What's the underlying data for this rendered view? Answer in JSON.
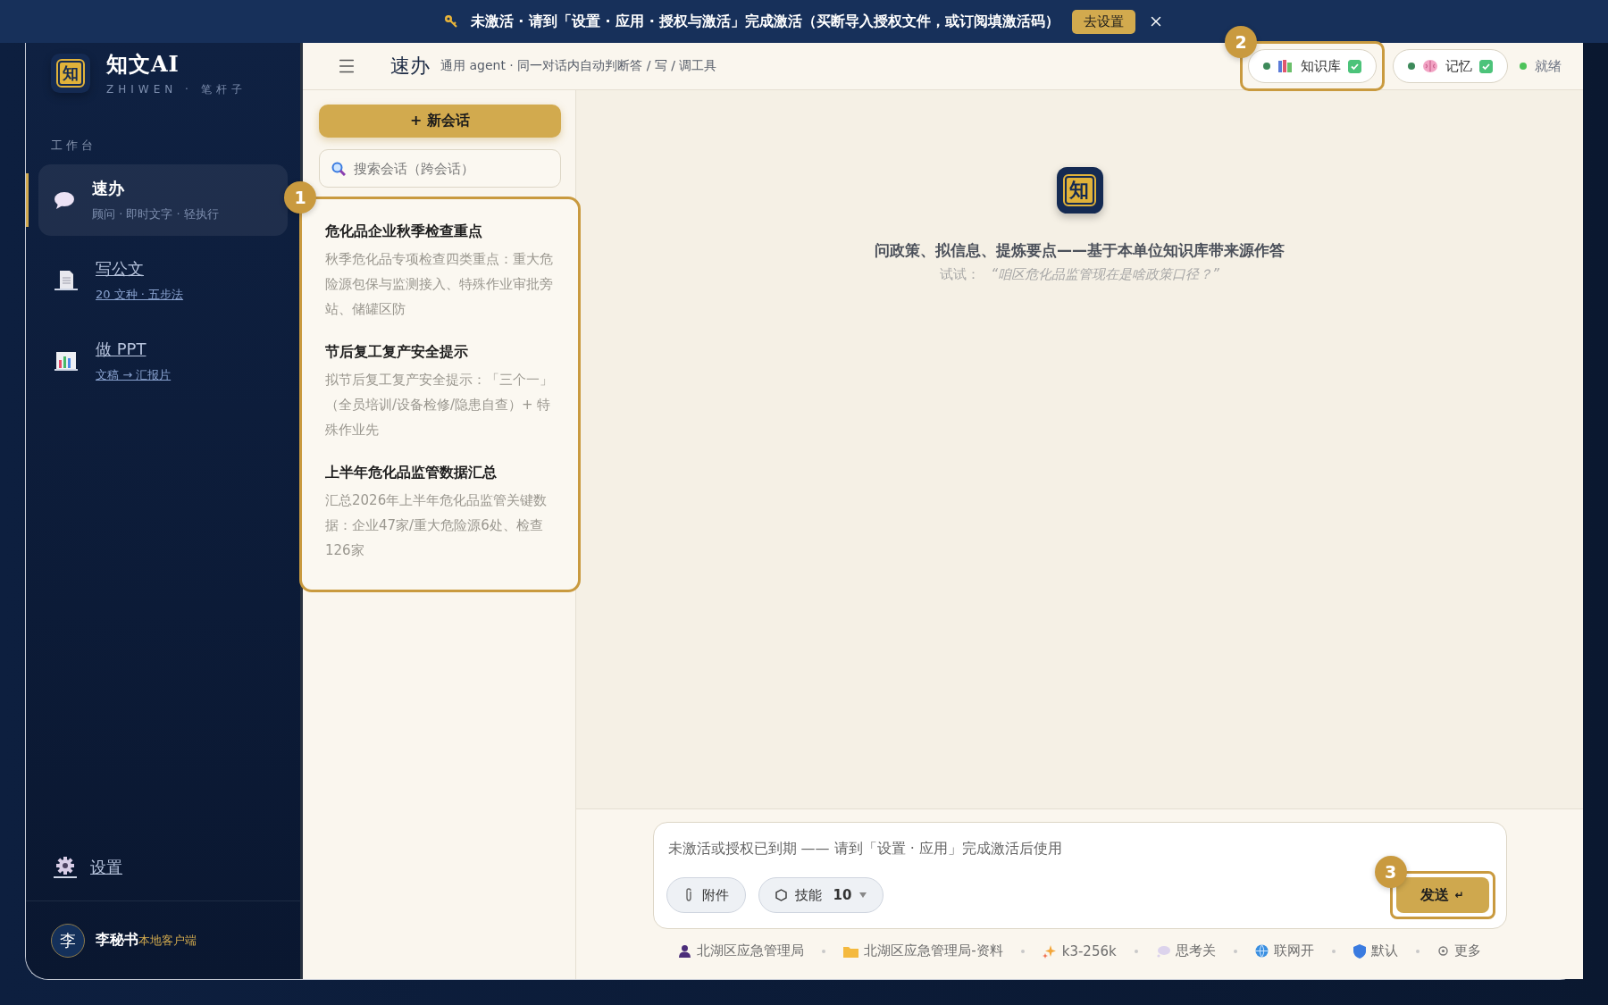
{
  "banner": {
    "message": "未激活 · 请到「设置 · 应用 · 授权与激活」完成激活（买断导入授权文件，或订阅填激活码）",
    "action": "去设置"
  },
  "sidebar": {
    "logo_glyph": "知",
    "brand": "知文AI",
    "brand_sub": "ZHIWEN · 笔杆子",
    "section": "工作台",
    "items": [
      {
        "kind": "chat",
        "title": "速办",
        "subtitle": "顾问 · 即时文字 · 轻执行",
        "selected": true
      },
      {
        "kind": "doc",
        "title": "写公文",
        "subtitle": "20 文种 · 五步法",
        "selected": false
      },
      {
        "kind": "ppt",
        "title": "做 PPT",
        "subtitle": "文稿 → 汇报片",
        "selected": false
      }
    ],
    "settings": "设置",
    "user": {
      "avatar": "李",
      "name": "李秘书",
      "tag": "本地客户端"
    }
  },
  "header": {
    "title": "速办",
    "subtitle": "通用 agent · 同一对话内自动判断答 / 写 / 调工具",
    "chips": [
      {
        "kind": "knowledge",
        "label": "知识库",
        "checked": true,
        "marker": "2"
      },
      {
        "kind": "memory",
        "label": "记忆",
        "checked": true
      }
    ],
    "status": "就绪"
  },
  "conversations": {
    "new_button": "+ 新会话",
    "search_placeholder": "搜索会话（跨会话）",
    "marker": "1",
    "items": [
      {
        "title": "危化品企业秋季检查重点",
        "snippet": "秋季危化品专项检查四类重点：重大危险源包保与监测接入、特殊作业审批旁站、储罐区防"
      },
      {
        "title": "节后复工复产安全提示",
        "snippet": "拟节后复工复产安全提示：「三个一」（全员培训/设备检修/隐患自查）+ 特殊作业先"
      },
      {
        "title": "上半年危化品监管数据汇总",
        "snippet": "汇总2026年上半年危化品监管关键数据：企业47家/重大危险源6处、检查126家"
      }
    ]
  },
  "chat": {
    "logo_glyph": "知",
    "headline": "问政策、拟信息、提炼要点——基于本单位知识库带来源作答",
    "hint_label": "试试：",
    "hint": "“咱区危化品监管现在是啥政策口径？”"
  },
  "composer": {
    "placeholder": "未激活或授权已到期 —— 请到「设置 · 应用」完成激活后使用",
    "attach": "附件",
    "skills_label": "技能",
    "skills_count": "10",
    "send": "发送",
    "send_hint": "↵",
    "marker": "3"
  },
  "status_items": [
    {
      "kind": "org",
      "label": "北湖区应急管理局"
    },
    {
      "kind": "folder",
      "label": "北湖区应急管理局-资料"
    },
    {
      "kind": "model",
      "label": "k3-256k"
    },
    {
      "kind": "thinking",
      "label": "思考关"
    },
    {
      "kind": "web",
      "label": "联网开"
    },
    {
      "kind": "policy",
      "label": "默认"
    },
    {
      "kind": "more",
      "label": "更多"
    }
  ]
}
